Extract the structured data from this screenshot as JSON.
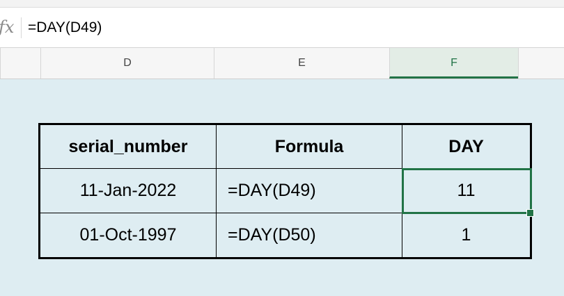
{
  "formula_bar": {
    "fx_label": "fx",
    "value": "=DAY(D49)"
  },
  "columns": [
    {
      "label": "D",
      "selected": false
    },
    {
      "label": "E",
      "selected": false
    },
    {
      "label": "F",
      "selected": true
    }
  ],
  "table": {
    "headers": [
      "serial_number",
      "Formula",
      "DAY"
    ],
    "rows": [
      {
        "serial_number": "11-Jan-2022",
        "formula": "=DAY(D49)",
        "day": "11"
      },
      {
        "serial_number": "01-Oct-1997",
        "formula": "=DAY(D50)",
        "day": "1"
      }
    ]
  },
  "colors": {
    "accent": "#217346",
    "sheet_background": "#deedf2"
  }
}
